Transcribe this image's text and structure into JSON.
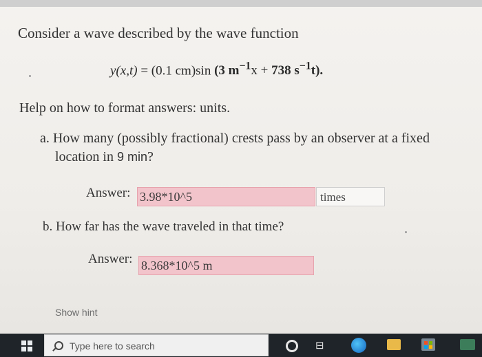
{
  "question": {
    "intro": "Consider a wave described by the wave function",
    "equation": {
      "lhs": "y(x,t)",
      "eq": " = (0.1 cm)sin",
      "arg_open": " (",
      "a": "3",
      "unit1": " m",
      "exp1": "−1",
      "mid": "x + ",
      "b": "738",
      "unit2": " s",
      "exp2": "−1",
      "tail": "t",
      "arg_close": ")."
    },
    "help": "Help on how to format answers: units.",
    "part_a": {
      "line1": "a. How many (possibly fractional) crests pass by an observer at a fixed",
      "line2_pre": "location in ",
      "line2_bold": "9 min",
      "line2_post": "?",
      "answer_label": "Answer:",
      "answer_value": "3.98*10^5",
      "unit": "times"
    },
    "part_b": {
      "text": "b. How far has the wave traveled in that time?",
      "answer_label": "Answer:",
      "answer_value": "8.368*10^5 m"
    },
    "hint": "Show hint"
  },
  "taskbar": {
    "search_placeholder": "Type here to search",
    "taskview_glyph": "⊟"
  },
  "colors": {
    "answer_fill": "#f2c4cb",
    "taskbar": "#1f2429"
  }
}
